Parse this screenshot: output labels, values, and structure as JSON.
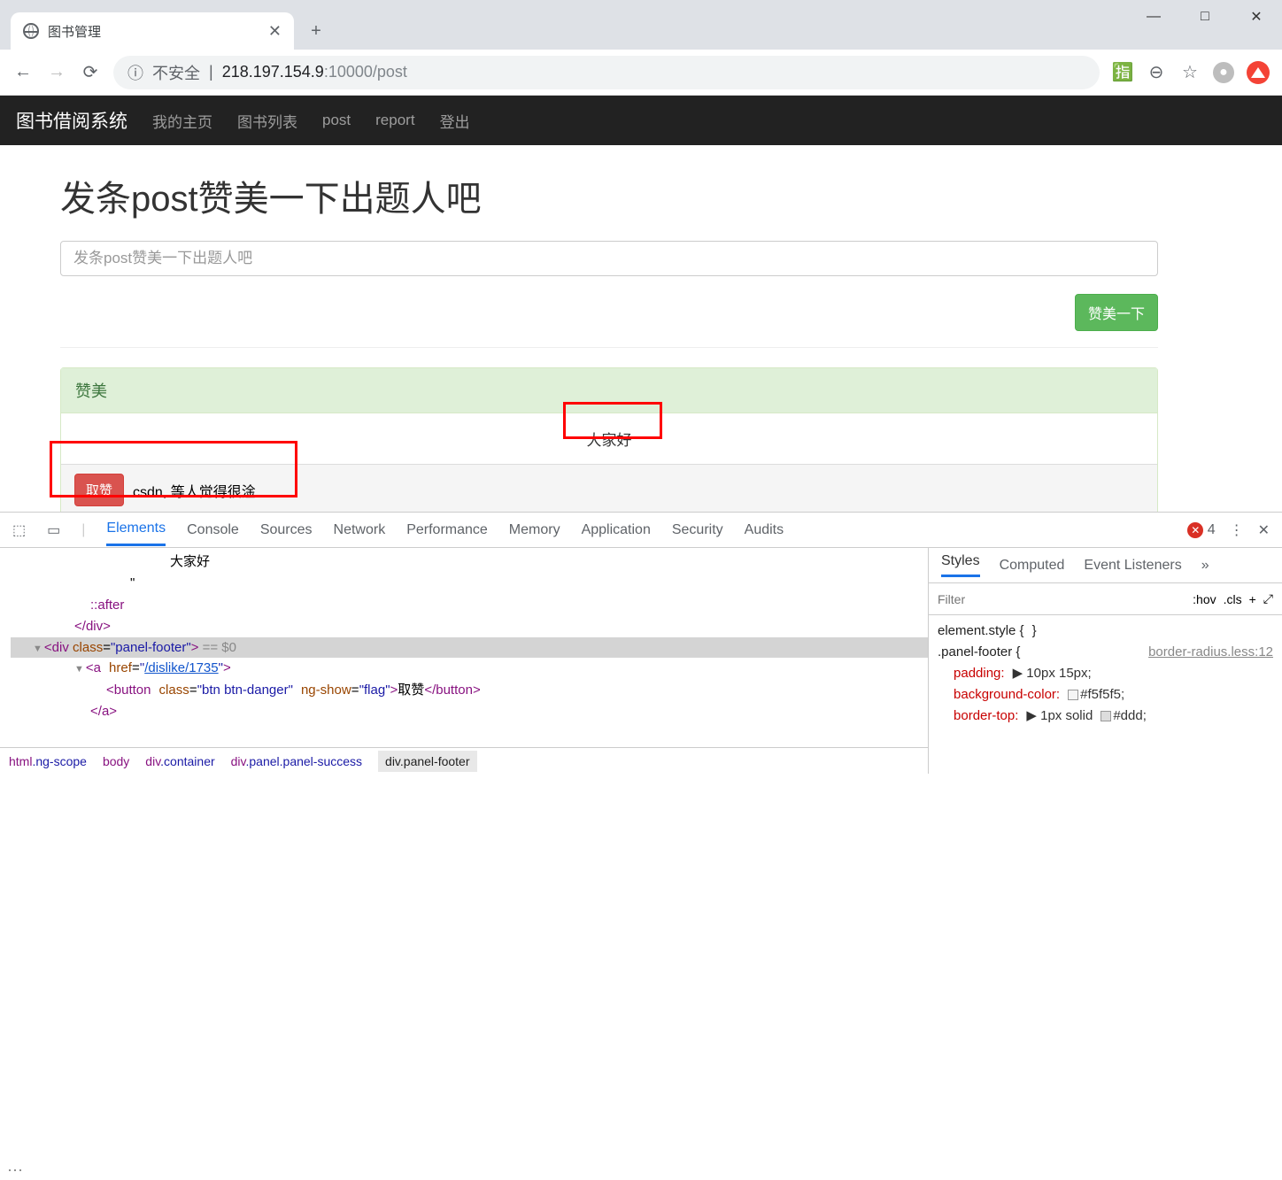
{
  "browser": {
    "tab_title": "图书管理",
    "url_prefix": "不安全",
    "url_host": "218.197.154.9",
    "url_port": ":10000",
    "url_path": "/post",
    "info_icon_label": "ⓘ"
  },
  "window": {
    "minimize": "—",
    "maximize": "□",
    "close": "✕"
  },
  "navbar": {
    "brand": "图书借阅系统",
    "items": [
      "我的主页",
      "图书列表",
      "post",
      "report",
      "登出"
    ]
  },
  "page": {
    "heading": "发条post赞美一下出题人吧",
    "placeholder": "发条post赞美一下出题人吧",
    "submit": "赞美一下",
    "panel_title": "赞美",
    "post_body": "大家好",
    "dislike_btn": "取赞",
    "footer_text": "csdn, 等人觉得很淦"
  },
  "devtools": {
    "inspect_icon": "⬚",
    "device_icon": "▭",
    "tabs": [
      "Elements",
      "Console",
      "Sources",
      "Network",
      "Performance",
      "Memory",
      "Application",
      "Security",
      "Audits"
    ],
    "error_count": "4",
    "settings_icon": "⋮",
    "close_icon": "✕",
    "code": {
      "text1": "大家好",
      "quote": "\"",
      "after": "::after",
      "div_close": "</div>",
      "panel_footer_open": "<div class=\"panel-footer\">",
      "eq0": " == $0",
      "a_open_pre": "<a href=\"",
      "a_href": "/dislike/1735",
      "a_open_post": "\">",
      "btn_line": "<button class=\"btn btn-danger\" ng-show=\"flag\">取赞</button>",
      "a_close": "</a>"
    },
    "crumbs": [
      {
        "tag": "html",
        "cls": ".ng-scope"
      },
      {
        "tag": "body",
        "cls": ""
      },
      {
        "tag": "div",
        "cls": ".container"
      },
      {
        "tag": "div",
        "cls": ".panel.panel-success"
      },
      {
        "tag": "div",
        "cls": ".panel-footer"
      }
    ],
    "styles": {
      "tabs": [
        "Styles",
        "Computed",
        "Event Listeners"
      ],
      "more": "»",
      "filter_ph": "Filter",
      "hov": ":hov",
      "cls": ".cls",
      "plus": "+",
      "element_style": "element.style {",
      "brace": "}",
      "selector": ".panel-footer {",
      "src": "border-radius.less:12",
      "p_padding": "padding:",
      "v_padding": "▶ 10px 15px;",
      "p_bg": "background-color:",
      "v_bg": "#f5f5f5;",
      "p_bt": "border-top:",
      "v_bt": "▶ 1px solid",
      "v_bt_c": "#ddd;"
    }
  }
}
